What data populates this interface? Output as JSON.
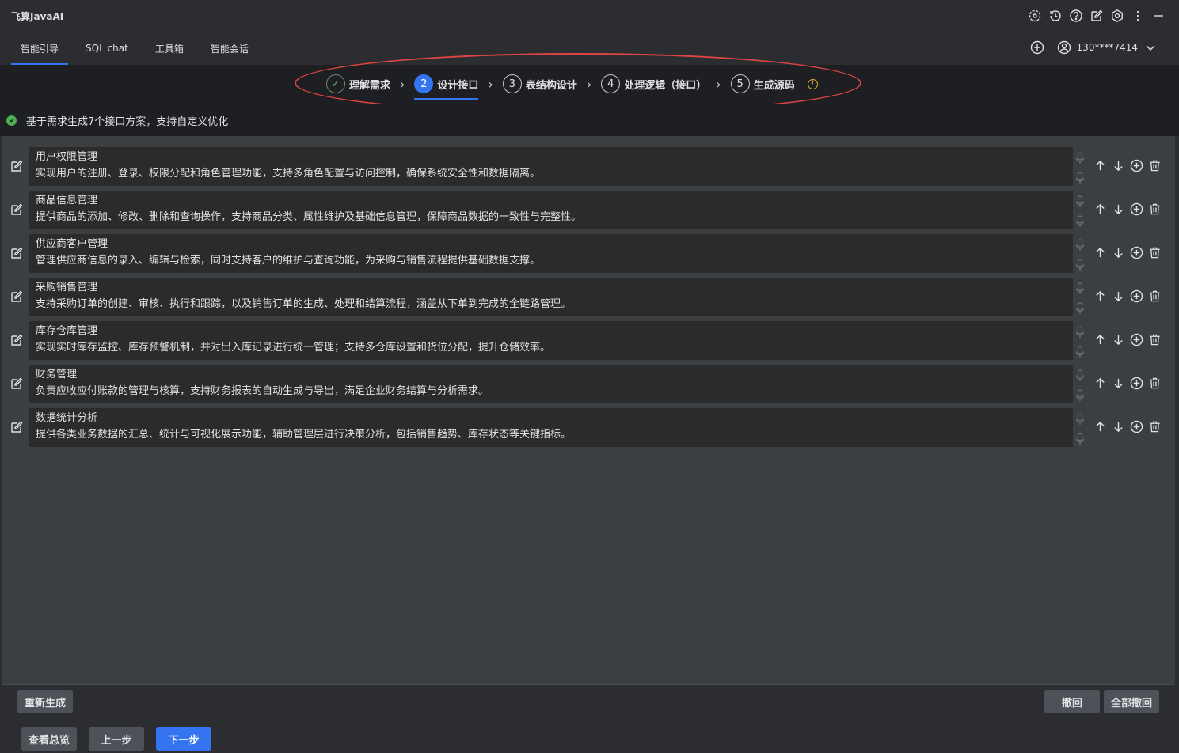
{
  "app": {
    "title": "飞算JavaAI"
  },
  "title_icons": [
    "settings-cog-icon",
    "history-icon",
    "help-icon",
    "edit-icon",
    "gear-icon",
    "more-vertical-icon",
    "minimize-icon"
  ],
  "tabs": [
    {
      "label": "智能引导",
      "active": true
    },
    {
      "label": "SQL chat",
      "active": false
    },
    {
      "label": "工具箱",
      "active": false
    },
    {
      "label": "智能会话",
      "active": false
    }
  ],
  "user": {
    "name": "130****7414"
  },
  "steps": [
    {
      "num": "✓",
      "label": "理解需求",
      "state": "done"
    },
    {
      "num": "2",
      "label": "设计接口",
      "state": "current"
    },
    {
      "num": "3",
      "label": "表结构设计",
      "state": "todo"
    },
    {
      "num": "4",
      "label": "处理逻辑（接口）",
      "state": "todo"
    },
    {
      "num": "5",
      "label": "生成源码",
      "state": "todo"
    }
  ],
  "status": {
    "text": "基于需求生成7个接口方案，支持自定义优化"
  },
  "interfaces": [
    {
      "name": "用户权限管理",
      "desc": "实现用户的注册、登录、权限分配和角色管理功能，支持多角色配置与访问控制，确保系统安全性和数据隔离。"
    },
    {
      "name": "商品信息管理",
      "desc": "提供商品的添加、修改、删除和查询操作，支持商品分类、属性维护及基础信息管理，保障商品数据的一致性与完整性。"
    },
    {
      "name": "供应商客户管理",
      "desc": "管理供应商信息的录入、编辑与检索，同时支持客户的维护与查询功能，为采购与销售流程提供基础数据支撑。"
    },
    {
      "name": "采购销售管理",
      "desc": "支持采购订单的创建、审核、执行和跟踪，以及销售订单的生成、处理和结算流程，涵盖从下单到完成的全链路管理。"
    },
    {
      "name": "库存仓库管理",
      "desc": "实现实时库存监控、库存预警机制，并对出入库记录进行统一管理；支持多仓库设置和货位分配，提升仓储效率。"
    },
    {
      "name": "财务管理",
      "desc": "负责应收应付账款的管理与核算，支持财务报表的自动生成与导出，满足企业财务结算与分析需求。"
    },
    {
      "name": "数据统计分析",
      "desc": "提供各类业务数据的汇总、统计与可视化展示功能，辅助管理层进行决策分析，包括销售趋势、库存状态等关键指标。"
    }
  ],
  "buttons": {
    "regenerate": "重新生成",
    "undo": "撤回",
    "undo_all": "全部撤回",
    "overview": "查看总览",
    "prev": "上一步",
    "next": "下一步"
  },
  "colors": {
    "accent": "#3574f0",
    "success": "#4caf50",
    "warning": "#e0b02a",
    "highlight": "#e04545"
  }
}
